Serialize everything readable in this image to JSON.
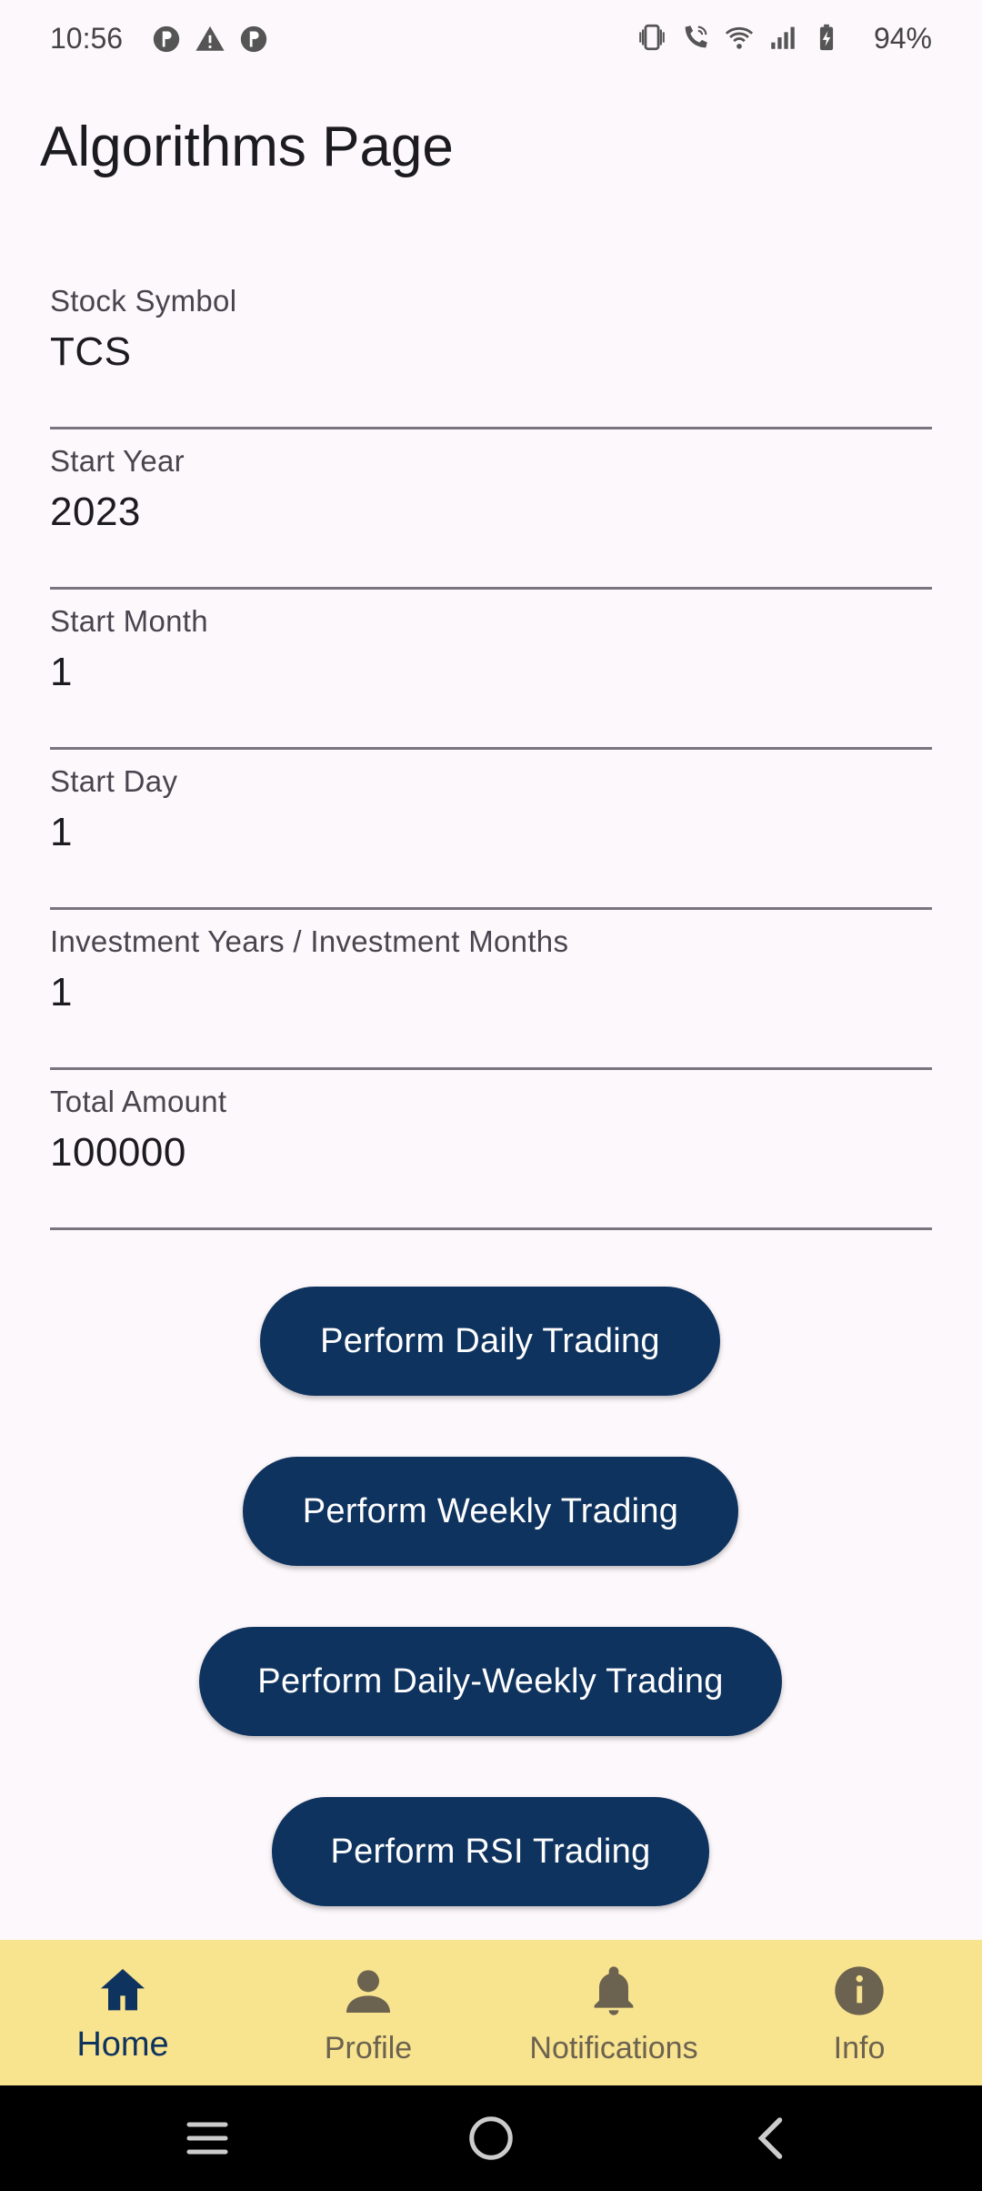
{
  "status_bar": {
    "time": "10:56",
    "battery": "94%",
    "left_icons": [
      "app-notification-icon",
      "warning-icon",
      "app-notification-icon"
    ],
    "right_icons": [
      "vibrate-icon",
      "wifi-calling-icon",
      "wifi-icon",
      "signal-icon",
      "battery-charging-icon"
    ]
  },
  "page": {
    "title": "Algorithms Page"
  },
  "form": {
    "fields": [
      {
        "label": "Stock Symbol",
        "value": "TCS"
      },
      {
        "label": "Start Year",
        "value": "2023"
      },
      {
        "label": "Start Month",
        "value": "1"
      },
      {
        "label": "Start Day",
        "value": "1"
      },
      {
        "label": "Investment Years / Investment Months",
        "value": "1"
      },
      {
        "label": "Total Amount",
        "value": "100000"
      }
    ]
  },
  "actions": {
    "daily": "Perform Daily Trading",
    "weekly": "Perform Weekly Trading",
    "daily_weekly": "Perform Daily-Weekly Trading",
    "rsi": "Perform RSI Trading"
  },
  "bottom_nav": {
    "items": [
      {
        "label": "Home",
        "icon": "home-icon",
        "active": true
      },
      {
        "label": "Profile",
        "icon": "person-icon",
        "active": false
      },
      {
        "label": "Notifications",
        "icon": "bell-icon",
        "active": false
      },
      {
        "label": "Info",
        "icon": "info-icon",
        "active": false
      }
    ]
  },
  "colors": {
    "button": "#0f335f",
    "nav_background": "#f8e38e",
    "nav_active": "#0f335f",
    "nav_inactive": "#6b6250"
  }
}
